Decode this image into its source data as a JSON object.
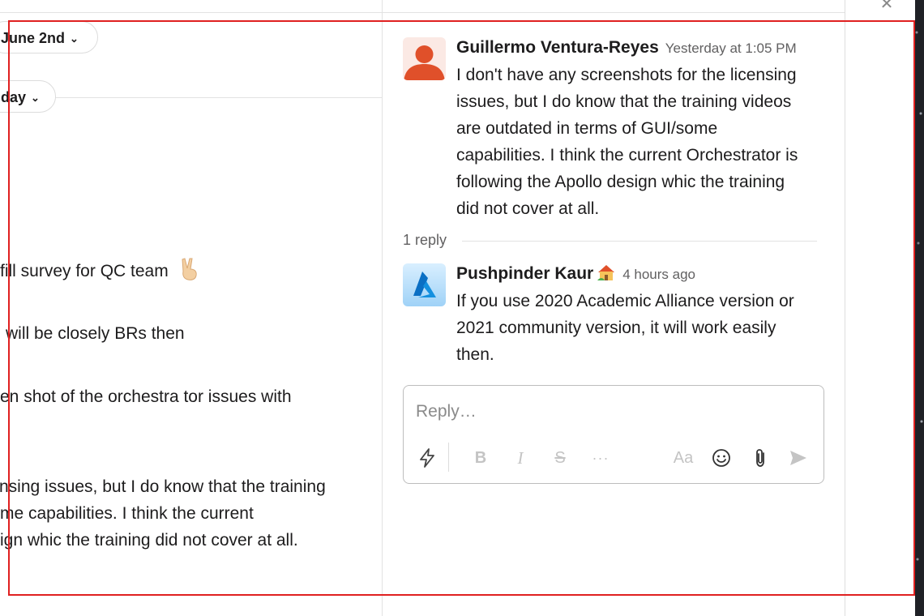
{
  "left": {
    "date_pill_1": "June 2nd",
    "date_pill_2": "day",
    "messages": [
      "fill survey for QC team",
      "will be closely BRs then",
      "en shot of the orchestra tor issues with",
      "nsing issues, but I do know that the training",
      "me capabilities. I think the current",
      "ign whic the training did not cover at all."
    ]
  },
  "thread": {
    "parent": {
      "author": "Guillermo Ventura-Reyes",
      "time": "Yesterday at 1:05 PM",
      "lines": [
        "I don't have any screenshots for the licensing",
        "issues, but I do know that the training videos",
        "are outdated in terms of GUI/some",
        "capabilities. I think the current Orchestrator is",
        "following the Apollo design whic the training",
        "did not cover at all."
      ]
    },
    "reply_count": "1 reply",
    "reply": {
      "author": "Pushpinder Kaur",
      "time": "4 hours ago",
      "lines": [
        "If you use 2020 Academic Alliance version or",
        "2021 community version, it will work easily",
        "then."
      ]
    },
    "composer": {
      "placeholder": "Reply…",
      "format_label": "Aa"
    }
  },
  "icons": {
    "close": "close-icon",
    "chevron": "chevron-down-icon",
    "shortcuts": "lightning-icon",
    "bold": "bold-icon",
    "italic": "italic-icon",
    "strike": "strikethrough-icon",
    "more": "more-icon",
    "emoji": "emoji-icon",
    "attach": "paperclip-icon",
    "send": "send-icon"
  },
  "colors": {
    "accent_red_box": "#e02020",
    "avatar_person": "#e0502a",
    "text_primary": "#1d1c1d",
    "text_muted": "#616061"
  }
}
